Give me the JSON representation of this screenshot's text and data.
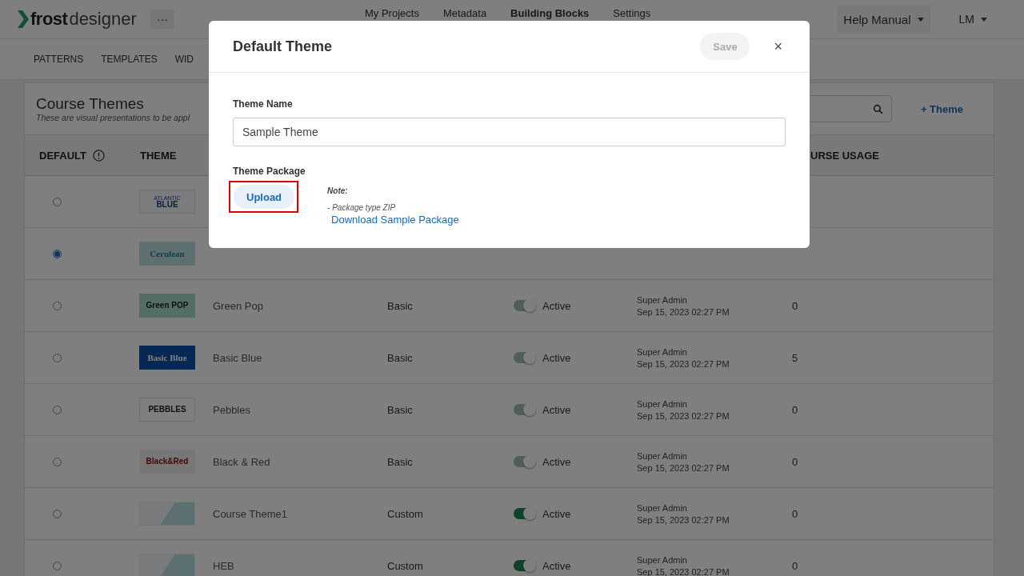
{
  "app": {
    "logo_bold": "frost",
    "logo_light": "designer",
    "more": "···",
    "nav": [
      {
        "label": "My Projects",
        "selected": false
      },
      {
        "label": "Metadata",
        "selected": false
      },
      {
        "label": "Building Blocks",
        "selected": true
      },
      {
        "label": "Settings",
        "selected": false
      }
    ],
    "help": "Help Manual",
    "user": "LM"
  },
  "subnav": [
    {
      "label": "PATTERNS",
      "selected": false
    },
    {
      "label": "TEMPLATES",
      "selected": false
    },
    {
      "label": "WID",
      "selected": false
    }
  ],
  "panel": {
    "title": "Course Themes",
    "subtitle": "These are visual presentations to be appl",
    "add_button": "+ Theme"
  },
  "table": {
    "columns": [
      {
        "label": "DEFAULT",
        "kind": "info"
      },
      {
        "label": "THEME",
        "kind": "plain"
      },
      {
        "label": "URSE USAGE",
        "kind": "usage"
      }
    ],
    "rows": [
      {
        "selected": false,
        "thumb": {
          "kind": "atlantic",
          "text": "BLUE",
          "small": "ATLANTIC"
        }
      },
      {
        "selected": true,
        "thumb": {
          "kind": "cerulean",
          "text": "Cerulean"
        }
      },
      {
        "selected": false,
        "thumb": {
          "kind": "green",
          "text": "Green POP"
        },
        "name": "Green Pop",
        "type": "Basic",
        "on": true,
        "disabled": true,
        "status": "Active",
        "modified_by": "Super Admin",
        "modified_at": "Sep 15, 2023 02:27 PM",
        "usage": "0"
      },
      {
        "selected": false,
        "thumb": {
          "kind": "blue",
          "text": "Basic Blue"
        },
        "name": "Basic Blue",
        "type": "Basic",
        "on": true,
        "disabled": true,
        "status": "Active",
        "modified_by": "Super Admin",
        "modified_at": "Sep 15, 2023 02:27 PM",
        "usage": "5"
      },
      {
        "selected": false,
        "thumb": {
          "kind": "pebbles",
          "text": "PEBBLES"
        },
        "name": "Pebbles",
        "type": "Basic",
        "on": true,
        "disabled": true,
        "status": "Active",
        "modified_by": "Super Admin",
        "modified_at": "Sep 15, 2023 02:27 PM",
        "usage": "0"
      },
      {
        "selected": false,
        "thumb": {
          "kind": "blackred",
          "text": "Black&Red"
        },
        "name": "Black & Red",
        "type": "Basic",
        "on": true,
        "disabled": true,
        "status": "Active",
        "modified_by": "Super Admin",
        "modified_at": "Sep 15, 2023 02:27 PM",
        "usage": "0"
      },
      {
        "selected": false,
        "thumb": {
          "kind": "custom"
        },
        "name": "Course Theme1",
        "type": "Custom",
        "on": true,
        "disabled": false,
        "status": "Active",
        "modified_by": "Super Admin",
        "modified_at": "Sep 15, 2023 02:27 PM",
        "usage": "0"
      },
      {
        "selected": false,
        "thumb": {
          "kind": "custom"
        },
        "name": "HEB",
        "type": "Custom",
        "on": true,
        "disabled": false,
        "status": "Active",
        "modified_by": "Super Admin",
        "modified_at": "Sep 15, 2023 02:27 PM",
        "usage": "0"
      }
    ]
  },
  "dialog": {
    "title": "Default Theme",
    "save": {
      "label": "Save",
      "disabled": true
    },
    "close": "×",
    "name_label": "Theme Name",
    "name_value": "Sample Theme",
    "package_label": "Theme Package",
    "upload": {
      "label": "Upload",
      "highlighted": true
    },
    "note_title": "Note:",
    "note_text": "- Package type ZIP",
    "download_link": "Download Sample Package"
  }
}
